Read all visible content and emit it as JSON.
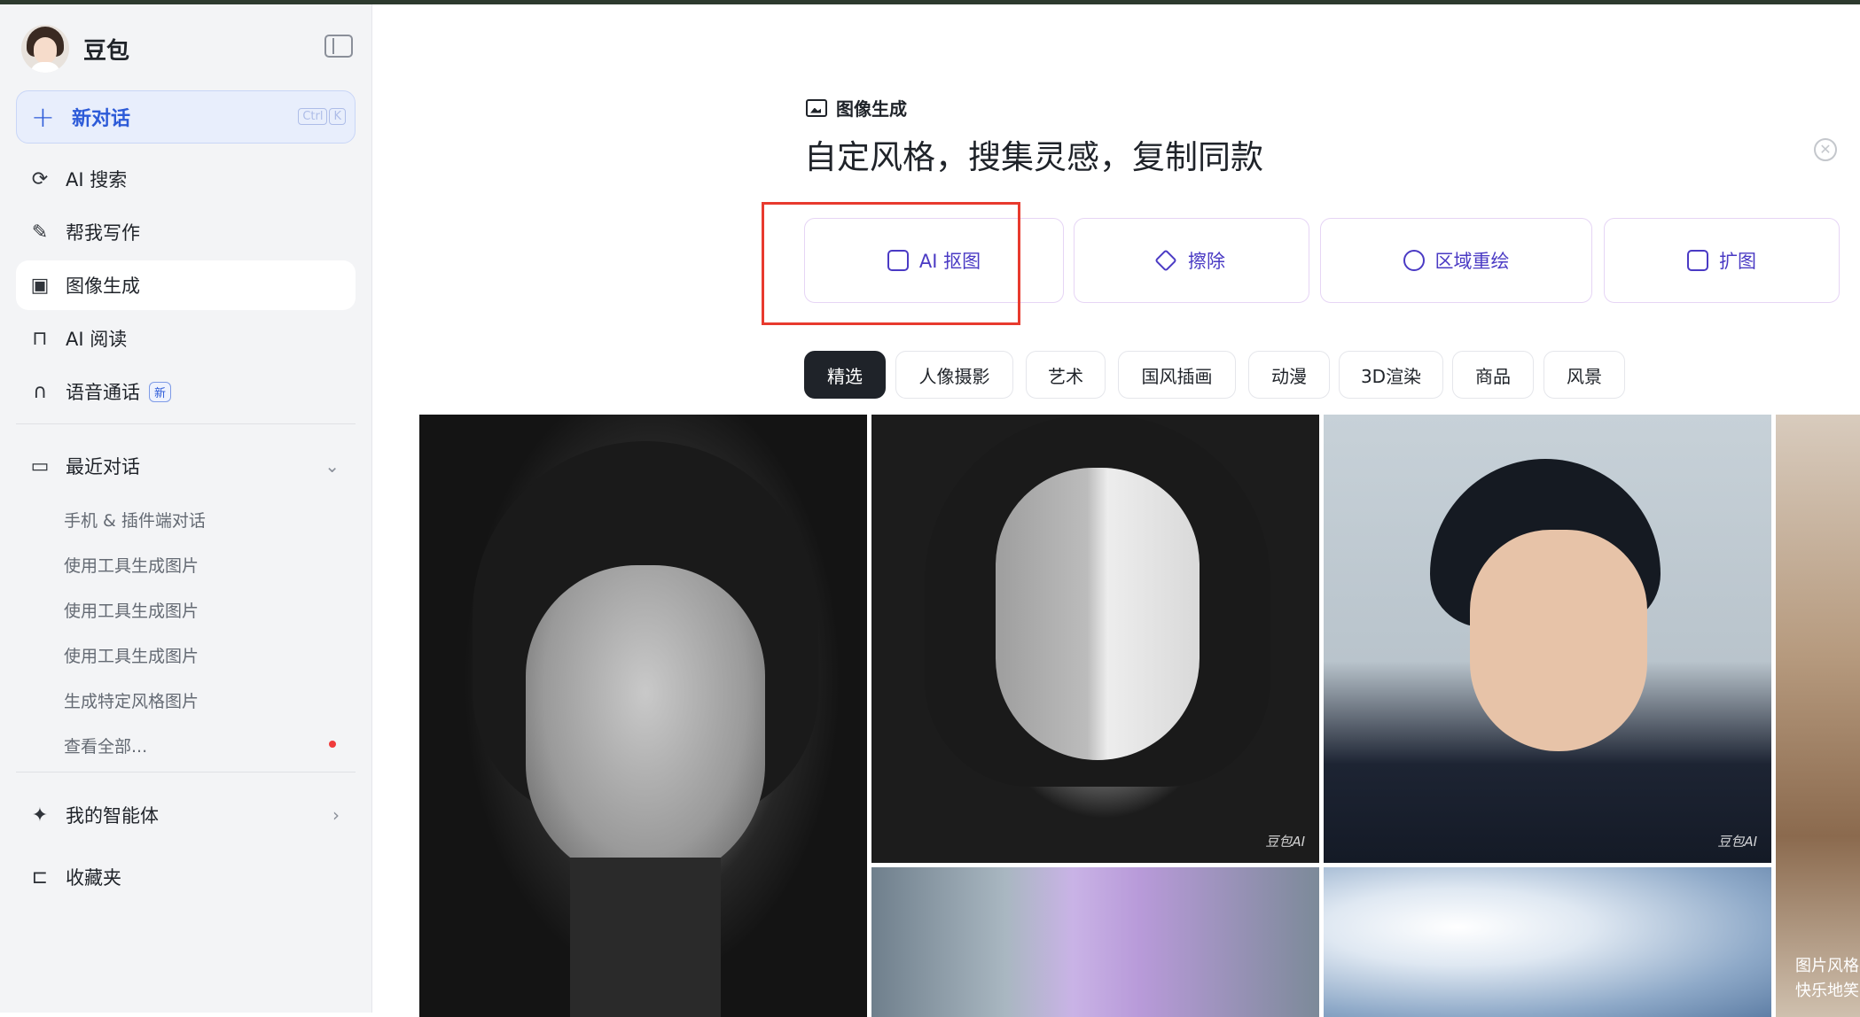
{
  "brand": {
    "name": "豆包"
  },
  "new_chat": {
    "label": "新对话",
    "shortcut": [
      "Ctrl",
      "K"
    ]
  },
  "nav": [
    {
      "label": "AI 搜索",
      "icon": "search-refresh-icon"
    },
    {
      "label": "帮我写作",
      "icon": "pen-icon"
    },
    {
      "label": "图像生成",
      "icon": "image-icon",
      "active": true
    },
    {
      "label": "AI 阅读",
      "icon": "book-icon"
    },
    {
      "label": "语音通话",
      "icon": "headphones-icon",
      "badge": "新"
    }
  ],
  "recent": {
    "label": "最近对话",
    "items": [
      "手机 & 插件端对话",
      "使用工具生成图片",
      "使用工具生成图片",
      "使用工具生成图片",
      "生成特定风格图片"
    ],
    "view_all": "查看全部..."
  },
  "agents": {
    "label": "我的智能体"
  },
  "favorites": {
    "label": "收藏夹"
  },
  "main": {
    "section_tag": "图像生成",
    "headline": "自定风格，搜集灵感，复制同款",
    "tools": [
      "AI 抠图",
      "擦除",
      "区域重绘",
      "扩图"
    ],
    "categories": [
      "精选",
      "人像摄影",
      "艺术",
      "国风插画",
      "动漫",
      "3D渲染",
      "商品",
      "风景"
    ],
    "watermark": "豆包AI",
    "caption_lines": [
      "图片风格",
      "快乐地笑"
    ]
  },
  "colors": {
    "accent": "#2d5bd8",
    "tool_text": "#4a3ac4",
    "highlight": "#e83a2e"
  }
}
